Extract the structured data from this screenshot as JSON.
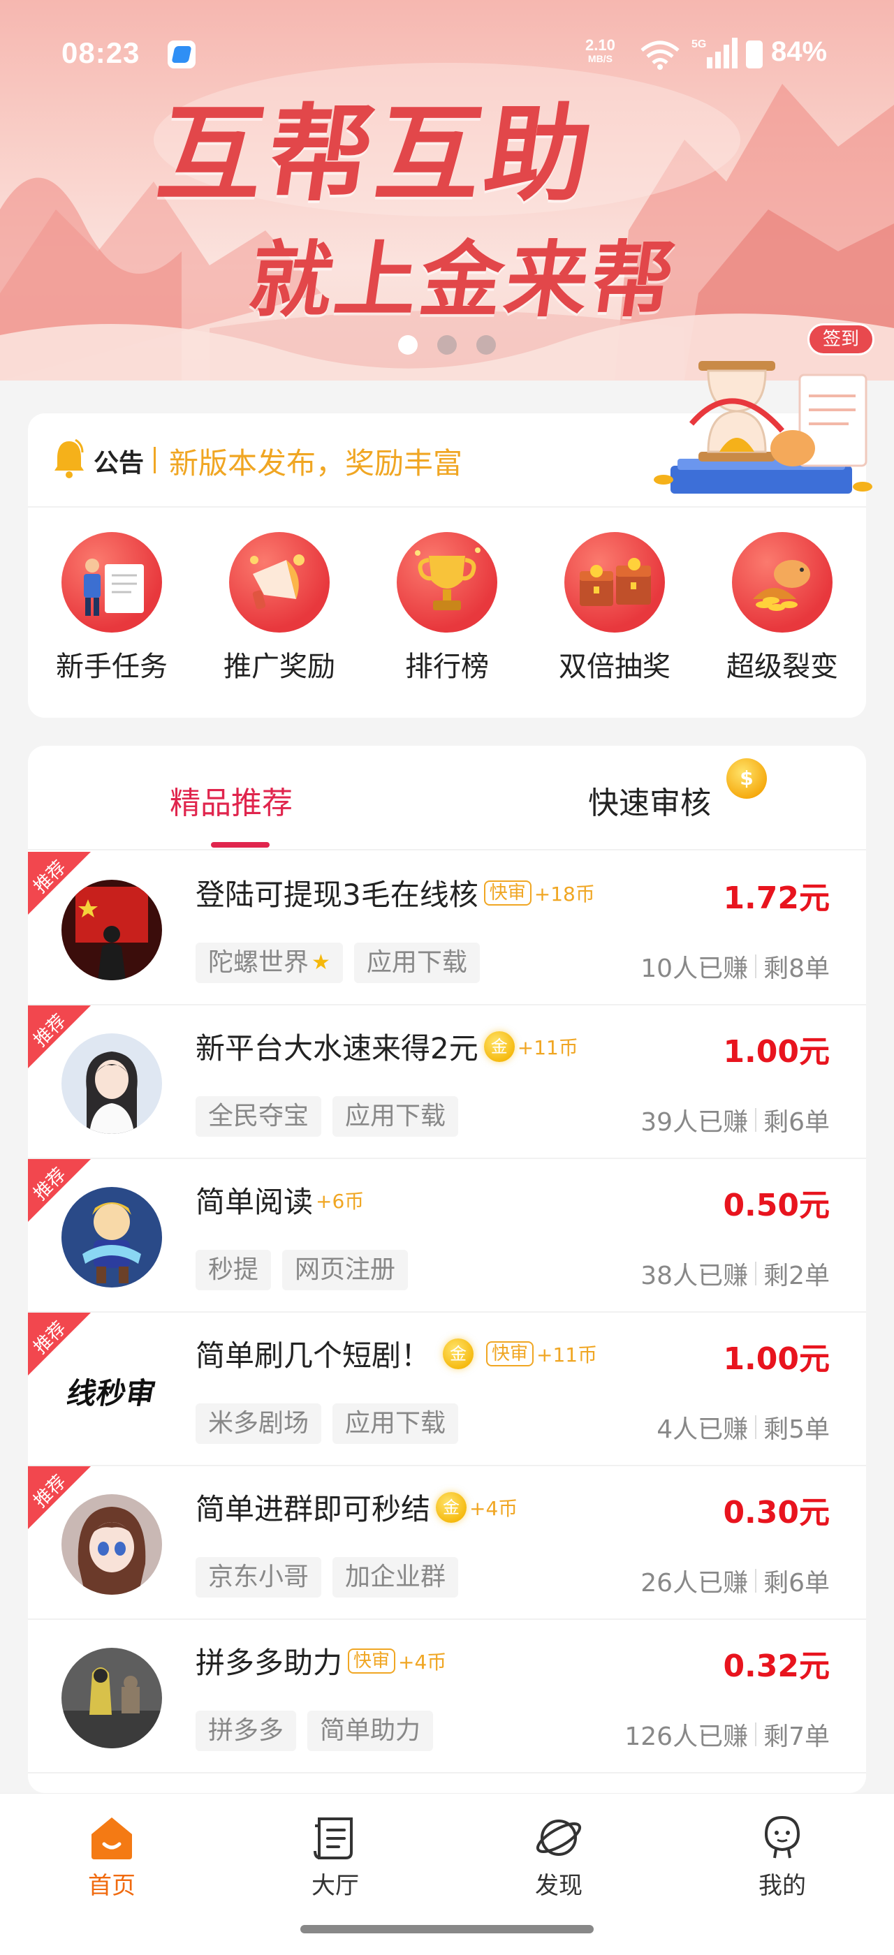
{
  "status_bar": {
    "time": "08:23",
    "net_speed": "2.10",
    "net_speed_unit": "MB/S",
    "network": "5G",
    "battery": "84%"
  },
  "banner": {
    "line1": "互帮互助",
    "line2": "就上金来帮",
    "slides": 3,
    "active_slide": 1,
    "signin_label": "签到"
  },
  "notice": {
    "label": "公告",
    "text": "新版本发布，奖励丰富"
  },
  "shortcuts": [
    {
      "label": "新手任务",
      "icon": "newbie-book-icon"
    },
    {
      "label": "推广奖励",
      "icon": "megaphone-icon"
    },
    {
      "label": "排行榜",
      "icon": "trophy-icon"
    },
    {
      "label": "双倍抽奖",
      "icon": "treasure-chest-icon"
    },
    {
      "label": "超级裂变",
      "icon": "piggy-bank-icon"
    }
  ],
  "tabs": {
    "active": "精品推荐",
    "inactive": "快速审核"
  },
  "tasks": [
    {
      "ribbon": "推荐",
      "title": "登陆可提现3毛在线核",
      "fast": "快审",
      "gold": false,
      "coins": "+18币",
      "price": "1.72元",
      "tags": [
        "陀螺世界",
        "应用下载"
      ],
      "star_on_first_tag": true,
      "earned": "10人已赚",
      "left": "剩8单"
    },
    {
      "ribbon": "推荐",
      "title": "新平台大水速来得2元",
      "fast": "",
      "gold": true,
      "coins": "+11币",
      "price": "1.00元",
      "tags": [
        "全民夺宝",
        "应用下载"
      ],
      "star_on_first_tag": false,
      "earned": "39人已赚",
      "left": "剩6单"
    },
    {
      "ribbon": "推荐",
      "title": "简单阅读",
      "fast": "",
      "gold": false,
      "coins": "+6币",
      "price": "0.50元",
      "tags": [
        "秒提",
        "网页注册"
      ],
      "star_on_first_tag": false,
      "earned": "38人已赚",
      "left": "剩2单"
    },
    {
      "ribbon": "推荐",
      "title": "简单刷几个短剧！",
      "fast": "快审",
      "gold": true,
      "coins": "+11币",
      "price": "1.00元",
      "tags": [
        "米多剧场",
        "应用下载"
      ],
      "star_on_first_tag": false,
      "earned": "4人已赚",
      "left": "剩5单"
    },
    {
      "ribbon": "推荐",
      "title": "简单进群即可秒结",
      "fast": "",
      "gold": true,
      "coins": "+4币",
      "price": "0.30元",
      "tags": [
        "京东小哥",
        "加企业群"
      ],
      "star_on_first_tag": false,
      "earned": "26人已赚",
      "left": "剩6单"
    },
    {
      "ribbon": "",
      "title": "拼多多助力",
      "fast": "快审",
      "gold": false,
      "coins": "+4币",
      "price": "0.32元",
      "tags": [
        "拼多多",
        "简单助力"
      ],
      "star_on_first_tag": false,
      "earned": "126人已赚",
      "left": "剩7单"
    }
  ],
  "gold_badge_label": "金",
  "avatar4_text": "线秒审",
  "bottom_nav": [
    {
      "label": "首页",
      "icon": "home-icon",
      "active": true
    },
    {
      "label": "大厅",
      "icon": "hall-list-icon",
      "active": false
    },
    {
      "label": "发现",
      "icon": "planet-discover-icon",
      "active": false
    },
    {
      "label": "我的",
      "icon": "profile-icon",
      "active": false
    }
  ],
  "colors": {
    "accent_red": "#e0254d",
    "price_red": "#e8141e",
    "gold": "#f0a623",
    "nav_active": "#f06a0f"
  }
}
